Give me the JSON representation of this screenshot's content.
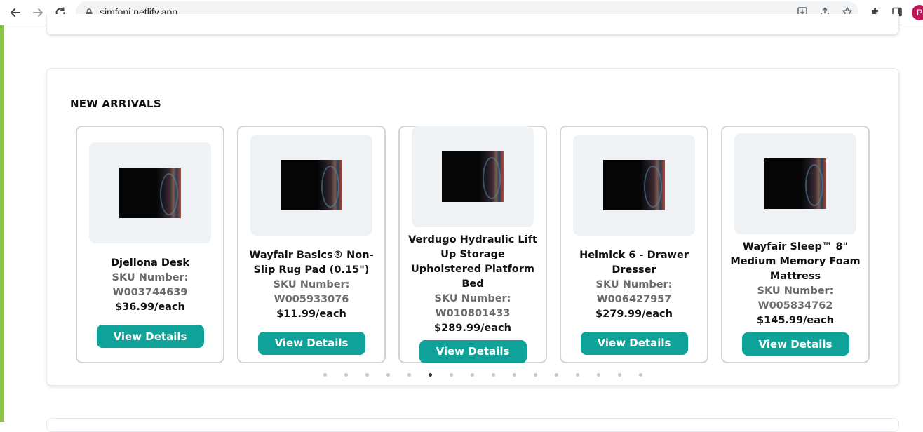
{
  "browser": {
    "url": "simfoni.netlify.app",
    "profile_initial": "P"
  },
  "section": {
    "title": "NEW ARRIVALS"
  },
  "products": [
    {
      "name": "Djellona Desk",
      "sku_label": "SKU Number:",
      "sku": "W003744639",
      "price": "$36.99/each",
      "button": "View Details"
    },
    {
      "name": "Wayfair Basics® Non-Slip Rug Pad (0.15\")",
      "sku_label": "SKU Number:",
      "sku": "W005933076",
      "price": "$11.99/each",
      "button": "View Details"
    },
    {
      "name": "Verdugo Hydraulic Lift Up Storage Upholstered Platform Bed",
      "sku_label": "SKU Number:",
      "sku": "W010801433",
      "price": "$289.99/each",
      "button": "View Details"
    },
    {
      "name": "Helmick 6 - Drawer Dresser",
      "sku_label": "SKU Number:",
      "sku": "W006427957",
      "price": "$279.99/each",
      "button": "View Details"
    },
    {
      "name": "Wayfair Sleep™ 8\" Medium Memory Foam Mattress",
      "sku_label": "SKU Number:",
      "sku": "W005834762",
      "price": "$145.99/each",
      "button": "View Details"
    }
  ],
  "carousel": {
    "dot_count": 16,
    "active_index": 5
  },
  "colors": {
    "button": "#0ea298",
    "accent_strip": "#8bc34a",
    "profile": "#c2185b"
  }
}
